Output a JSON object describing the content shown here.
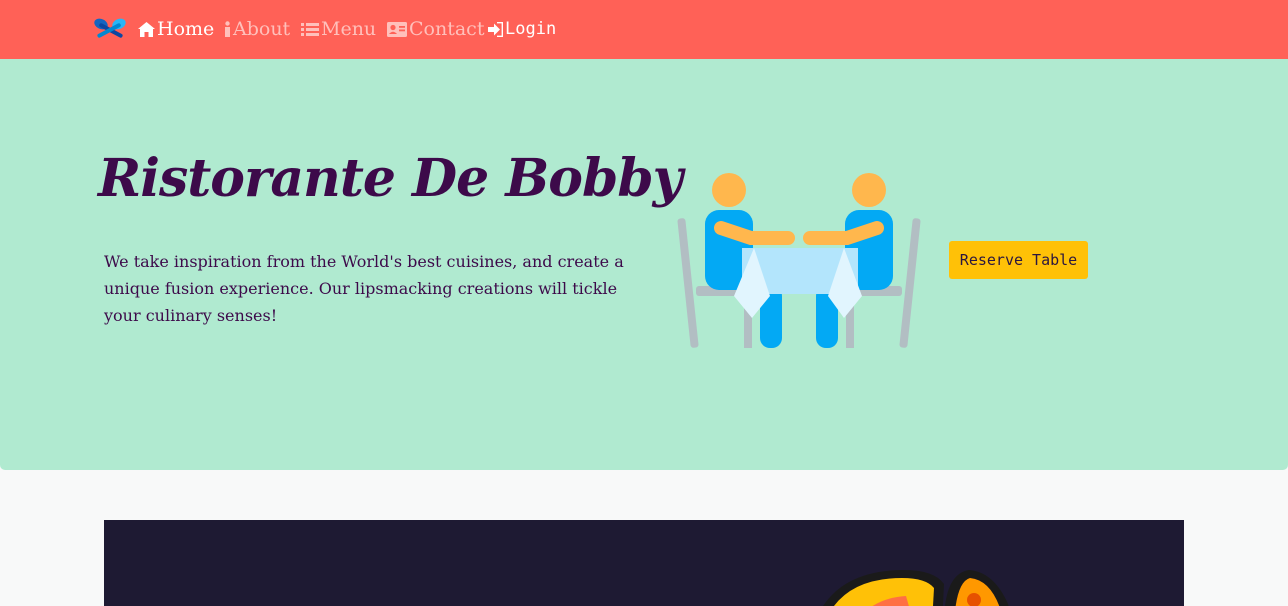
{
  "nav": {
    "brand_icon": "spoon-fork-icon",
    "items": [
      {
        "label": "Home",
        "icon": "home-icon",
        "state": "active"
      },
      {
        "label": "About",
        "icon": "info-icon",
        "state": "muted"
      },
      {
        "label": "Menu",
        "icon": "list-icon",
        "state": "muted"
      },
      {
        "label": "Contact",
        "icon": "contact-card-icon",
        "state": "muted"
      },
      {
        "label": "Login",
        "icon": "sign-in-icon",
        "state": "active"
      }
    ]
  },
  "hero": {
    "title": "Ristorante De Bobby",
    "lead": "We take inspiration from the World's best cuisines, and create a unique fusion experience. Our lipsmacking creations will tickle your culinary senses!",
    "illustration": "dining-table-icon",
    "reserve_label": "Reserve Table"
  },
  "colors": {
    "navbar": "#ff6157",
    "jumbotron": "#b0ead0",
    "title": "#3d0a4a",
    "button": "#ffc107",
    "panel": "#1e1a33"
  }
}
